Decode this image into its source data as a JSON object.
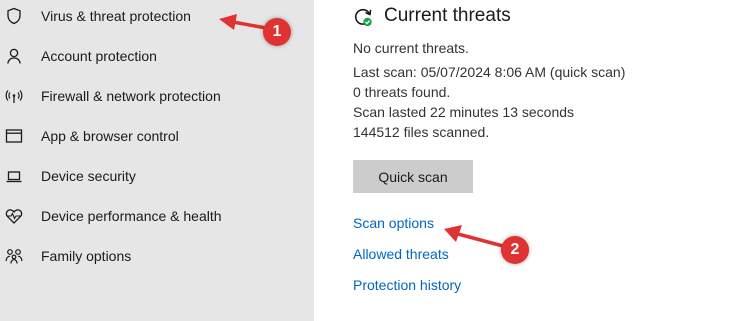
{
  "sidebar": {
    "items": [
      {
        "label": "Virus & threat protection",
        "icon": "shield-icon"
      },
      {
        "label": "Account protection",
        "icon": "person-icon"
      },
      {
        "label": "Firewall & network protection",
        "icon": "antenna-icon"
      },
      {
        "label": "App & browser control",
        "icon": "app-window-icon"
      },
      {
        "label": "Device security",
        "icon": "laptop-icon"
      },
      {
        "label": "Device performance & health",
        "icon": "heart-pulse-icon"
      },
      {
        "label": "Family options",
        "icon": "family-icon"
      }
    ]
  },
  "main": {
    "title": "Current threats",
    "title_icon": "refresh-check-icon",
    "status_lines": [
      "No current threats.",
      "Last scan: 05/07/2024 8:06 AM (quick scan)",
      "0 threats found.",
      "Scan lasted 22 minutes 13 seconds",
      "144512 files scanned."
    ],
    "quick_scan_label": "Quick scan",
    "links": [
      "Scan options",
      "Allowed threats",
      "Protection history"
    ]
  },
  "annotations": {
    "badge_1": "1",
    "badge_2": "2",
    "color": "#e03232"
  },
  "colors": {
    "sidebar_bg": "#e6e6e6",
    "link": "#0067c0",
    "button_bg": "#cccccc",
    "check_green": "#16a34a"
  }
}
